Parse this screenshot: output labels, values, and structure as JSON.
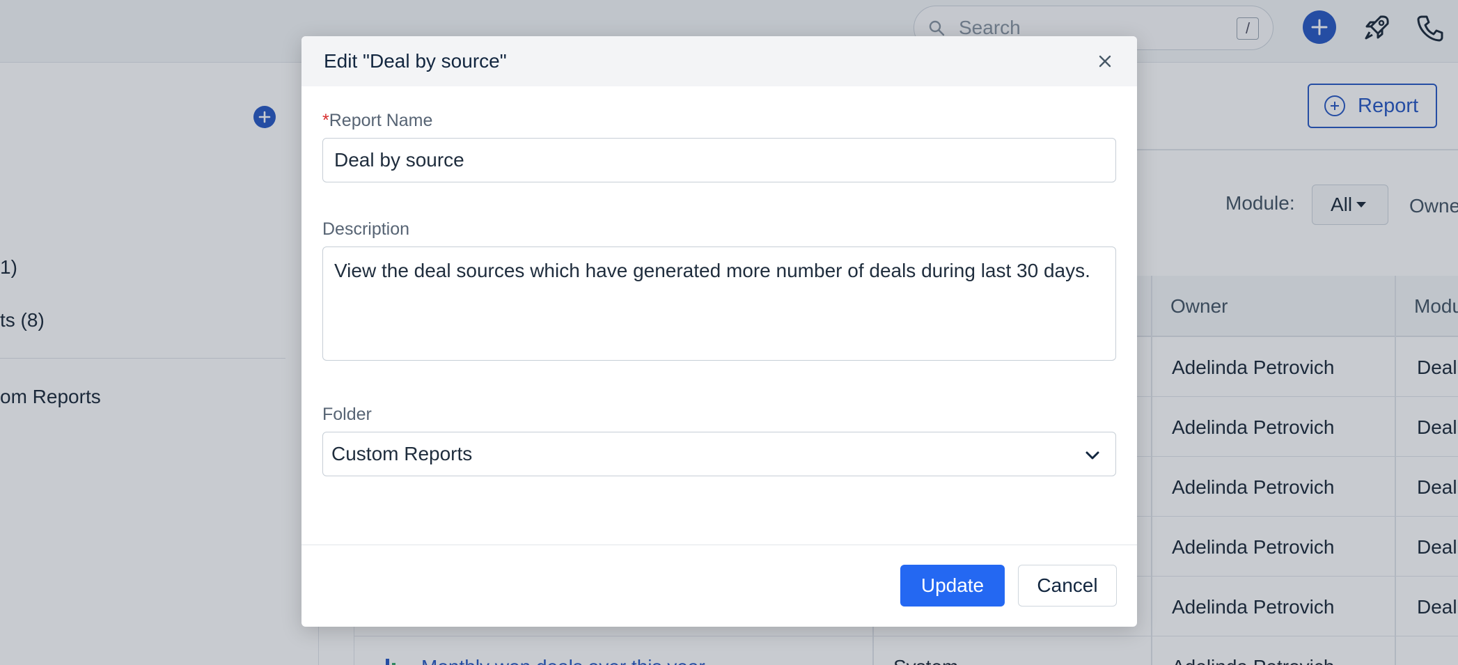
{
  "topbar": {
    "search_placeholder": "Search",
    "search_shortcut": "/",
    "icons": {
      "search": "search-icon",
      "add": "plus-icon",
      "rocket": "rocket-icon",
      "phone": "phone-icon"
    }
  },
  "sidebar": {
    "items": [
      {
        "label": "1)"
      },
      {
        "label": "ts (8)"
      },
      {
        "label": "om Reports"
      }
    ]
  },
  "toolbar": {
    "report_button": "Report",
    "module_label": "Module:",
    "module_value": "All",
    "owner_label": "Owne"
  },
  "table": {
    "headers": {
      "owner": "Owner",
      "module": "Modu"
    },
    "rows": [
      {
        "owner": "Adelinda Petrovich",
        "module": "Deal"
      },
      {
        "owner": "Adelinda Petrovich",
        "module": "Deal"
      },
      {
        "owner": "Adelinda Petrovich",
        "module": "Deal"
      },
      {
        "owner": "Adelinda Petrovich",
        "module": "Deal"
      },
      {
        "owner": "Adelinda Petrovich",
        "module": "Deal"
      }
    ],
    "partial_row": {
      "name": "Monthly won deals over this year",
      "type": "System",
      "owner": "Adelinda Petrovich"
    }
  },
  "modal": {
    "title": "Edit \"Deal by source\"",
    "report_name_required_mark": "*",
    "report_name_label": "Report Name",
    "report_name_value": "Deal by source",
    "description_label": "Description",
    "description_value": "View the deal sources which have generated more number of deals during last 30 days.",
    "folder_label": "Folder",
    "folder_value": "Custom Reports",
    "update_label": "Update",
    "cancel_label": "Cancel"
  },
  "colors": {
    "primary": "#2c5cc5",
    "update_button": "#2468f2",
    "required": "#d72d2d"
  }
}
